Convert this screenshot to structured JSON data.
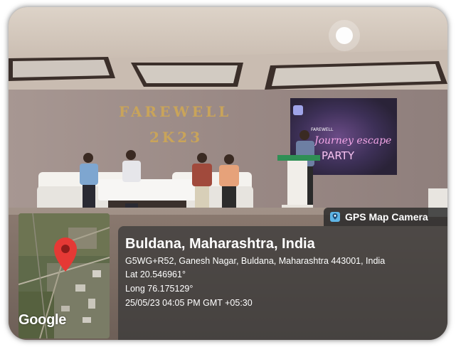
{
  "photo": {
    "banner_text_line1": "FAREWELL",
    "banner_text_line2": "2K23",
    "screen_header": "FAREWELL",
    "screen_text1": "Journey escape",
    "screen_text2": "PARTY"
  },
  "badge": {
    "label": "GPS Map Camera",
    "icon": "gps-map-camera-icon"
  },
  "map": {
    "logo_text": "Google",
    "pin_color": "#e53935"
  },
  "location": {
    "title": "Buldana, Maharashtra, India",
    "address": "G5WG+R52, Ganesh Nagar, Buldana, Maharashtra 443001, India",
    "latitude": "Lat 20.546961°",
    "longitude": "Long 76.175129°",
    "datetime": "25/05/23 04:05 PM GMT +05:30"
  }
}
